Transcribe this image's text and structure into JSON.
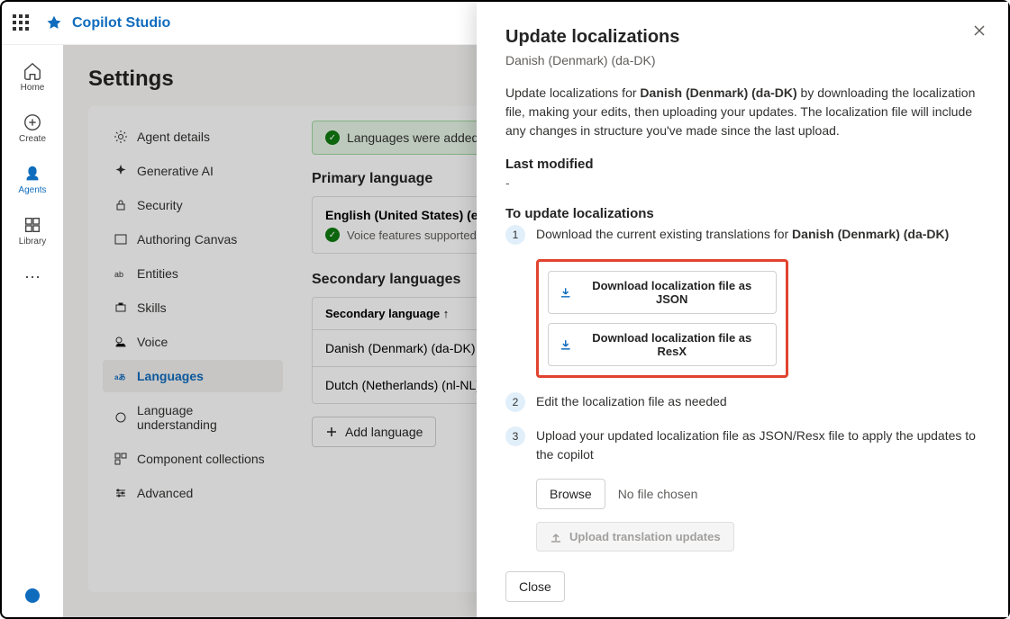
{
  "brand": "Copilot Studio",
  "rail": {
    "home": "Home",
    "create": "Create",
    "agents": "Agents",
    "library": "Library"
  },
  "page_title": "Settings",
  "settings_nav": {
    "agent_details": "Agent details",
    "generative_ai": "Generative AI",
    "security": "Security",
    "authoring_canvas": "Authoring Canvas",
    "entities": "Entities",
    "skills": "Skills",
    "voice": "Voice",
    "languages": "Languages",
    "language_understanding": "Language understanding",
    "component_collections": "Component collections",
    "advanced": "Advanced"
  },
  "toast": "Languages were added",
  "primary_section": "Primary language",
  "primary_lang": "English (United States) (en-US)",
  "primary_voice": "Voice features supported",
  "secondary_section": "Secondary languages",
  "table_header": "Secondary language ↑",
  "rows": {
    "danish": "Danish (Denmark) (da-DK)",
    "dutch": "Dutch (Netherlands) (nl-NL)"
  },
  "add_language": "Add language",
  "panel": {
    "title": "Update localizations",
    "subtitle": "Danish (Denmark) (da-DK)",
    "desc_pre": "Update localizations for ",
    "desc_bold": "Danish (Denmark) (da-DK)",
    "desc_post": " by downloading the localization file, making your edits, then uploading your updates. The localization file will include any changes in structure you've made since the last upload.",
    "last_modified_label": "Last modified",
    "last_modified_value": "-",
    "to_update": "To update localizations",
    "step1_pre": "Download the current existing translations for ",
    "step1_bold": "Danish (Denmark) (da-DK)",
    "download_json": "Download localization file as JSON",
    "download_resx": "Download localization file as ResX",
    "step2": "Edit the localization file as needed",
    "step3": "Upload your updated localization file as JSON/Resx file to apply the updates to the copilot",
    "browse": "Browse",
    "no_file": "No file chosen",
    "upload": "Upload translation updates",
    "close": "Close"
  }
}
